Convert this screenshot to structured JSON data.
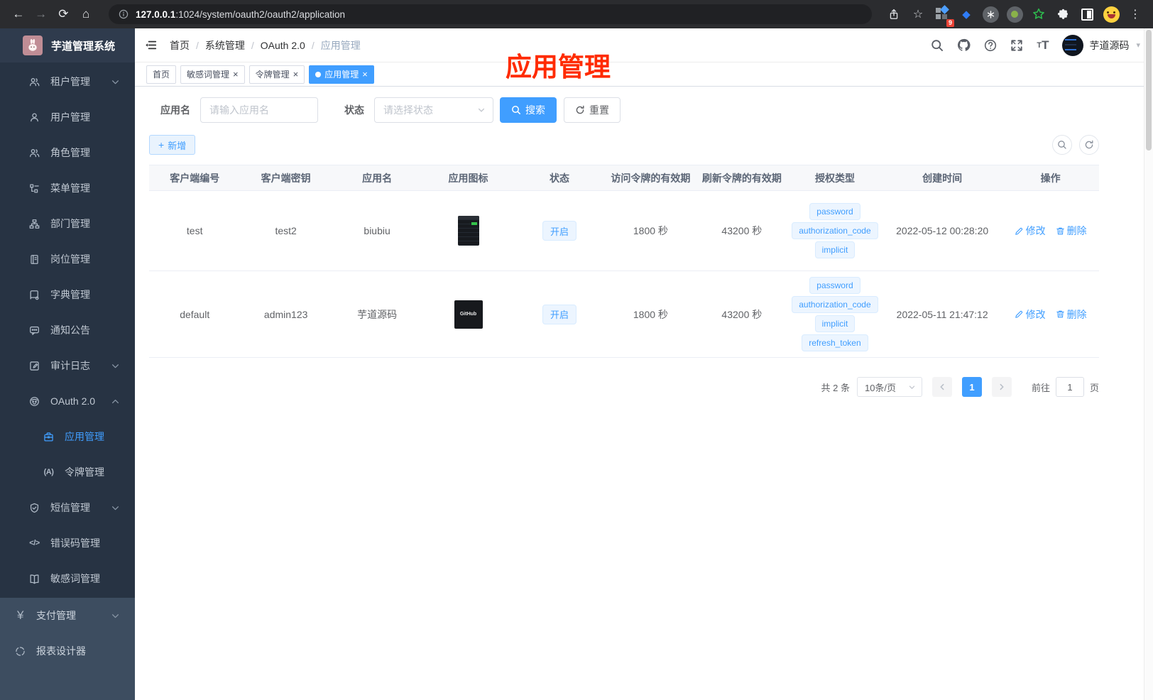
{
  "browser": {
    "url_host": "127.0.0.1",
    "url_rest": ":1024/system/oauth2/oauth2/application",
    "ext_badge": "9"
  },
  "annotation": {
    "text": "应用管理"
  },
  "sidebar": {
    "title": "芋道管理系统",
    "menu": [
      {
        "label": "租户管理",
        "icon": "users",
        "arrow": "down"
      },
      {
        "label": "用户管理",
        "icon": "user"
      },
      {
        "label": "角色管理",
        "icon": "users"
      },
      {
        "label": "菜单管理",
        "icon": "menu-tree"
      },
      {
        "label": "部门管理",
        "icon": "org-chart"
      },
      {
        "label": "岗位管理",
        "icon": "badge"
      },
      {
        "label": "字典管理",
        "icon": "dictionary"
      },
      {
        "label": "通知公告",
        "icon": "announcement"
      },
      {
        "label": "审计日志",
        "icon": "audit-log",
        "arrow": "down"
      },
      {
        "label": "OAuth 2.0",
        "icon": "oauth",
        "arrow": "up"
      },
      {
        "label": "应用管理",
        "icon": "application",
        "child": true,
        "active": true
      },
      {
        "label": "令牌管理",
        "icon": "token",
        "child": true
      },
      {
        "label": "短信管理",
        "icon": "sms-shield",
        "arrow": "down"
      },
      {
        "label": "错误码管理",
        "icon": "error-code"
      },
      {
        "label": "敏感词管理",
        "icon": "sensitive-word"
      }
    ],
    "root_menu": [
      {
        "label": "支付管理",
        "icon": "payment-yen",
        "arrow": "down"
      },
      {
        "label": "报表设计器",
        "icon": "report-designer"
      }
    ]
  },
  "navbar": {
    "breadcrumb": [
      "首页",
      "系统管理",
      "OAuth 2.0",
      "应用管理"
    ],
    "username": "芋道源码"
  },
  "tabs": [
    {
      "label": "首页",
      "closable": false,
      "active": false
    },
    {
      "label": "敏感词管理",
      "closable": true,
      "active": false
    },
    {
      "label": "令牌管理",
      "closable": true,
      "active": false
    },
    {
      "label": "应用管理",
      "closable": true,
      "active": true
    }
  ],
  "filters": {
    "name_label": "应用名",
    "name_placeholder": "请输入应用名",
    "status_label": "状态",
    "status_placeholder": "请选择状态",
    "search_label": "搜索",
    "reset_label": "重置"
  },
  "toolbar": {
    "add_label": "新增"
  },
  "table": {
    "columns": [
      {
        "key": "client_id",
        "label": "客户端编号",
        "width": 9.6
      },
      {
        "key": "client_secret",
        "label": "客户端密钥",
        "width": 9.6
      },
      {
        "key": "name",
        "label": "应用名",
        "width": 9.6
      },
      {
        "key": "icon",
        "label": "应用图标",
        "width": 9.6
      },
      {
        "key": "status",
        "label": "状态",
        "width": 9.6
      },
      {
        "key": "access_ttl",
        "label": "访问令牌的有效期",
        "width": 9.6
      },
      {
        "key": "refresh_ttl",
        "label": "刷新令牌的有效期",
        "width": 9.6
      },
      {
        "key": "grants",
        "label": "授权类型",
        "width": 10.0
      },
      {
        "key": "created_at",
        "label": "创建时间",
        "width": 12.6
      },
      {
        "key": "actions",
        "label": "操作",
        "width": 10.2
      }
    ],
    "rows": [
      {
        "client_id": "test",
        "client_secret": "test2",
        "name": "biubiu",
        "icon": "app-screenshot",
        "status": "开启",
        "access_ttl": "1800 秒",
        "refresh_ttl": "43200 秒",
        "grants": [
          "password",
          "authorization_code",
          "implicit"
        ],
        "created_at": "2022-05-12 00:28:20"
      },
      {
        "client_id": "default",
        "client_secret": "admin123",
        "name": "芋道源码",
        "icon": "github-logo",
        "icon_text": "GitHub",
        "status": "开启",
        "access_ttl": "1800 秒",
        "refresh_ttl": "43200 秒",
        "grants": [
          "password",
          "authorization_code",
          "implicit",
          "refresh_token"
        ],
        "created_at": "2022-05-11 21:47:12"
      }
    ],
    "action_labels": {
      "edit": "修改",
      "delete": "删除"
    }
  },
  "pagination": {
    "total": "共 2 条",
    "page_size": "10条/页",
    "current_page": "1",
    "goto_label": "前往",
    "goto_value": "1",
    "unit_label": "页"
  },
  "colors": {
    "accent": "#409eff",
    "annotation_red": "#ff2b00",
    "sidebar_bg": "#273343",
    "sidebar_root_bg": "#3d4d60",
    "tag_bg": "#ecf5ff"
  }
}
